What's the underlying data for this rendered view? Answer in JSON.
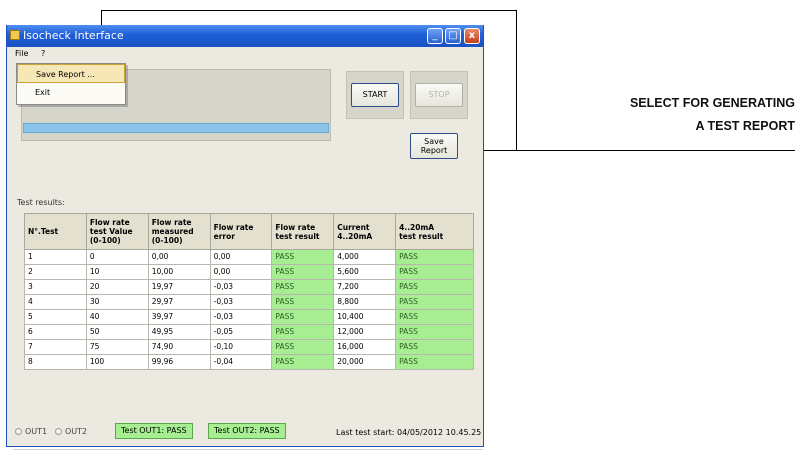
{
  "window": {
    "title": "Isocheck Interface",
    "controls": {
      "minimize": "_",
      "maximize": "□",
      "close": "x"
    }
  },
  "menu": {
    "items": [
      "File",
      "?"
    ],
    "dropdown": [
      "Save Report ...",
      "Exit"
    ]
  },
  "buttons": {
    "start": "START",
    "stop": "STOP",
    "save_report_line1": "Save",
    "save_report_line2": "Report"
  },
  "results": {
    "label": "Test results:",
    "headers": [
      [
        "N°.Test"
      ],
      [
        "Flow rate",
        "test Value",
        "(0-100)"
      ],
      [
        "Flow rate",
        "measured",
        "(0-100)"
      ],
      [
        "Flow rate",
        "error"
      ],
      [
        "Flow rate",
        "test result"
      ],
      [
        "Current",
        "4..20mA"
      ],
      [
        "4..20mA",
        "test result"
      ]
    ],
    "rows": [
      [
        "1",
        "0",
        "0,00",
        "0,00",
        "PASS",
        "4,000",
        "PASS"
      ],
      [
        "2",
        "10",
        "10,00",
        "0,00",
        "PASS",
        "5,600",
        "PASS"
      ],
      [
        "3",
        "20",
        "19,97",
        "-0,03",
        "PASS",
        "7,200",
        "PASS"
      ],
      [
        "4",
        "30",
        "29,97",
        "-0,03",
        "PASS",
        "8,800",
        "PASS"
      ],
      [
        "5",
        "40",
        "39,97",
        "-0,03",
        "PASS",
        "10,400",
        "PASS"
      ],
      [
        "6",
        "50",
        "49,95",
        "-0,05",
        "PASS",
        "12,000",
        "PASS"
      ],
      [
        "7",
        "75",
        "74,90",
        "-0,10",
        "PASS",
        "16,000",
        "PASS"
      ],
      [
        "8",
        "100",
        "99,96",
        "-0,04",
        "PASS",
        "20,000",
        "PASS"
      ]
    ]
  },
  "status": {
    "out1": "OUT1",
    "out2": "OUT2",
    "test_out1": "Test OUT1: PASS",
    "test_out2": "Test OUT2: PASS",
    "last_test": "Last test start: 04/05/2012 10.45.25"
  },
  "callout": {
    "line1": "SELECT FOR GENERATING",
    "line2": "A TEST REPORT"
  },
  "colors": {
    "pass": "#a7ee93",
    "titlebar": "#1d5ed6"
  }
}
